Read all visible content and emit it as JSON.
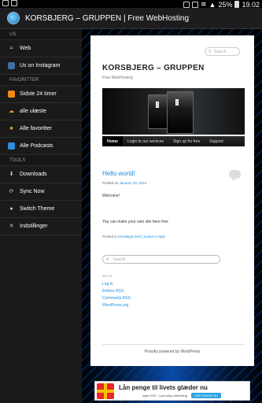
{
  "status_bar": {
    "battery": "25%",
    "time": "19.02"
  },
  "titlebar": {
    "title": "KORSBJERG – GRUPPEN | Free WebHosting",
    "app_icon": "globe-icon"
  },
  "sidebar": {
    "sections": [
      {
        "heading": "US",
        "items": [
          {
            "label": "Web",
            "icon": "wifi-icon"
          },
          {
            "label": "Us on Instagram",
            "icon": "instagram-icon"
          }
        ]
      },
      {
        "heading": "FAVORITTER",
        "items": [
          {
            "label": "Sidste 24 timer",
            "icon": "rss-icon"
          },
          {
            "label": "alle ulæste",
            "icon": "unread-icon"
          },
          {
            "label": "Alle favoritter",
            "icon": "star-icon"
          },
          {
            "label": "Alle Podcasts",
            "icon": "podcast-icon"
          }
        ]
      },
      {
        "heading": "TOOLS",
        "items": [
          {
            "label": "Downloads",
            "icon": "download-icon"
          },
          {
            "label": "Sync Now",
            "icon": "sync-icon"
          },
          {
            "label": "Switch Theme",
            "icon": "theme-icon"
          },
          {
            "label": "Indstillinger",
            "icon": "settings-icon"
          }
        ]
      }
    ]
  },
  "site": {
    "search_placeholder": "Search",
    "title": "KORSBJERG – GRUPPEN",
    "tagline": "Free WebHosting",
    "nav": [
      "Home",
      "Login to our services",
      "Sign up for free",
      "Support"
    ],
    "post": {
      "title": "Hello world!",
      "meta_prefix": "Posted on",
      "date": "January 20, 2012",
      "body1": "Welcome!",
      "body2": "You can make your own site here free",
      "foot_prefix": "Posted in",
      "category": "Uncategorized",
      "separator": "|",
      "reply": "Leave a reply"
    },
    "sidebar_search_placeholder": "Search",
    "meta_heading": "META",
    "meta_links": [
      "Log in",
      "Entries RSS",
      "Comments RSS",
      "WordPress.org"
    ],
    "powered_by": "Proudly powered by WordPress"
  },
  "ad": {
    "headline": "Lån penge til livets glæder nu",
    "sub": "ingen RKI - Lynhurtig udbetaling",
    "cta": "LÅN PENGE NU"
  }
}
